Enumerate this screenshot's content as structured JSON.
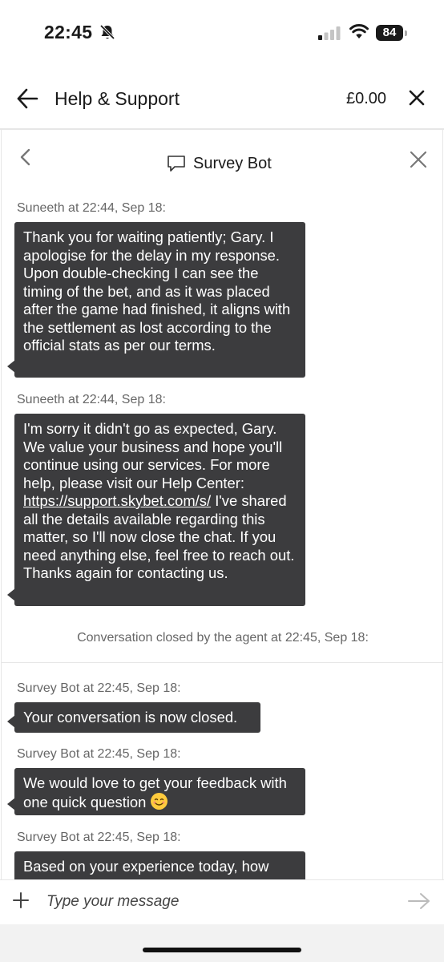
{
  "status_bar": {
    "time": "22:45",
    "battery": "84"
  },
  "header": {
    "title": "Help & Support",
    "balance": "£0.00"
  },
  "chat": {
    "title": "Survey Bot",
    "messages": [
      {
        "sender": "Suneeth at 22:44, Sep 18:",
        "text": "Thank you for waiting patiently; Gary. I apologise for the delay in my response. Upon double-checking I can see the timing of the bet, and as it was placed after the game had finished, it aligns with the settlement as lost according to the official stats as per our terms."
      },
      {
        "sender": "Suneeth at 22:44, Sep 18:",
        "text_before": "I'm sorry it didn't go as expected, Gary. We value your business and hope you'll continue using our services. For more help, please visit our Help Center: ",
        "link": "https://support.skybet.com/s/",
        "text_after": " I've shared all the details available regarding this matter, so I'll now close the chat. If you need anything else, feel free to reach out. Thanks again for contacting us."
      },
      {
        "sender": "Survey Bot at 22:45, Sep 18:",
        "text": "Your conversation is now closed."
      },
      {
        "sender": "Survey Bot at 22:45, Sep 18:",
        "text": "We would love to get your feedback with one quick question"
      },
      {
        "sender": "Survey Bot at 22:45, Sep 18:",
        "text": "Based on your experience today, how"
      }
    ],
    "system_note": "Conversation closed by the agent at 22:45, Sep 18:"
  },
  "composer": {
    "placeholder": "Type your message"
  },
  "colors": {
    "bubble": "#3c3c3e",
    "muted_text": "#666666",
    "divider": "#e6e6e6"
  },
  "icons": [
    "bell-slash-icon",
    "signal-icon",
    "wifi-icon",
    "back-arrow-icon",
    "close-icon",
    "chevron-left-icon",
    "chat-bubble-icon",
    "plus-icon",
    "send-arrow-icon",
    "smile-emoji-icon"
  ]
}
